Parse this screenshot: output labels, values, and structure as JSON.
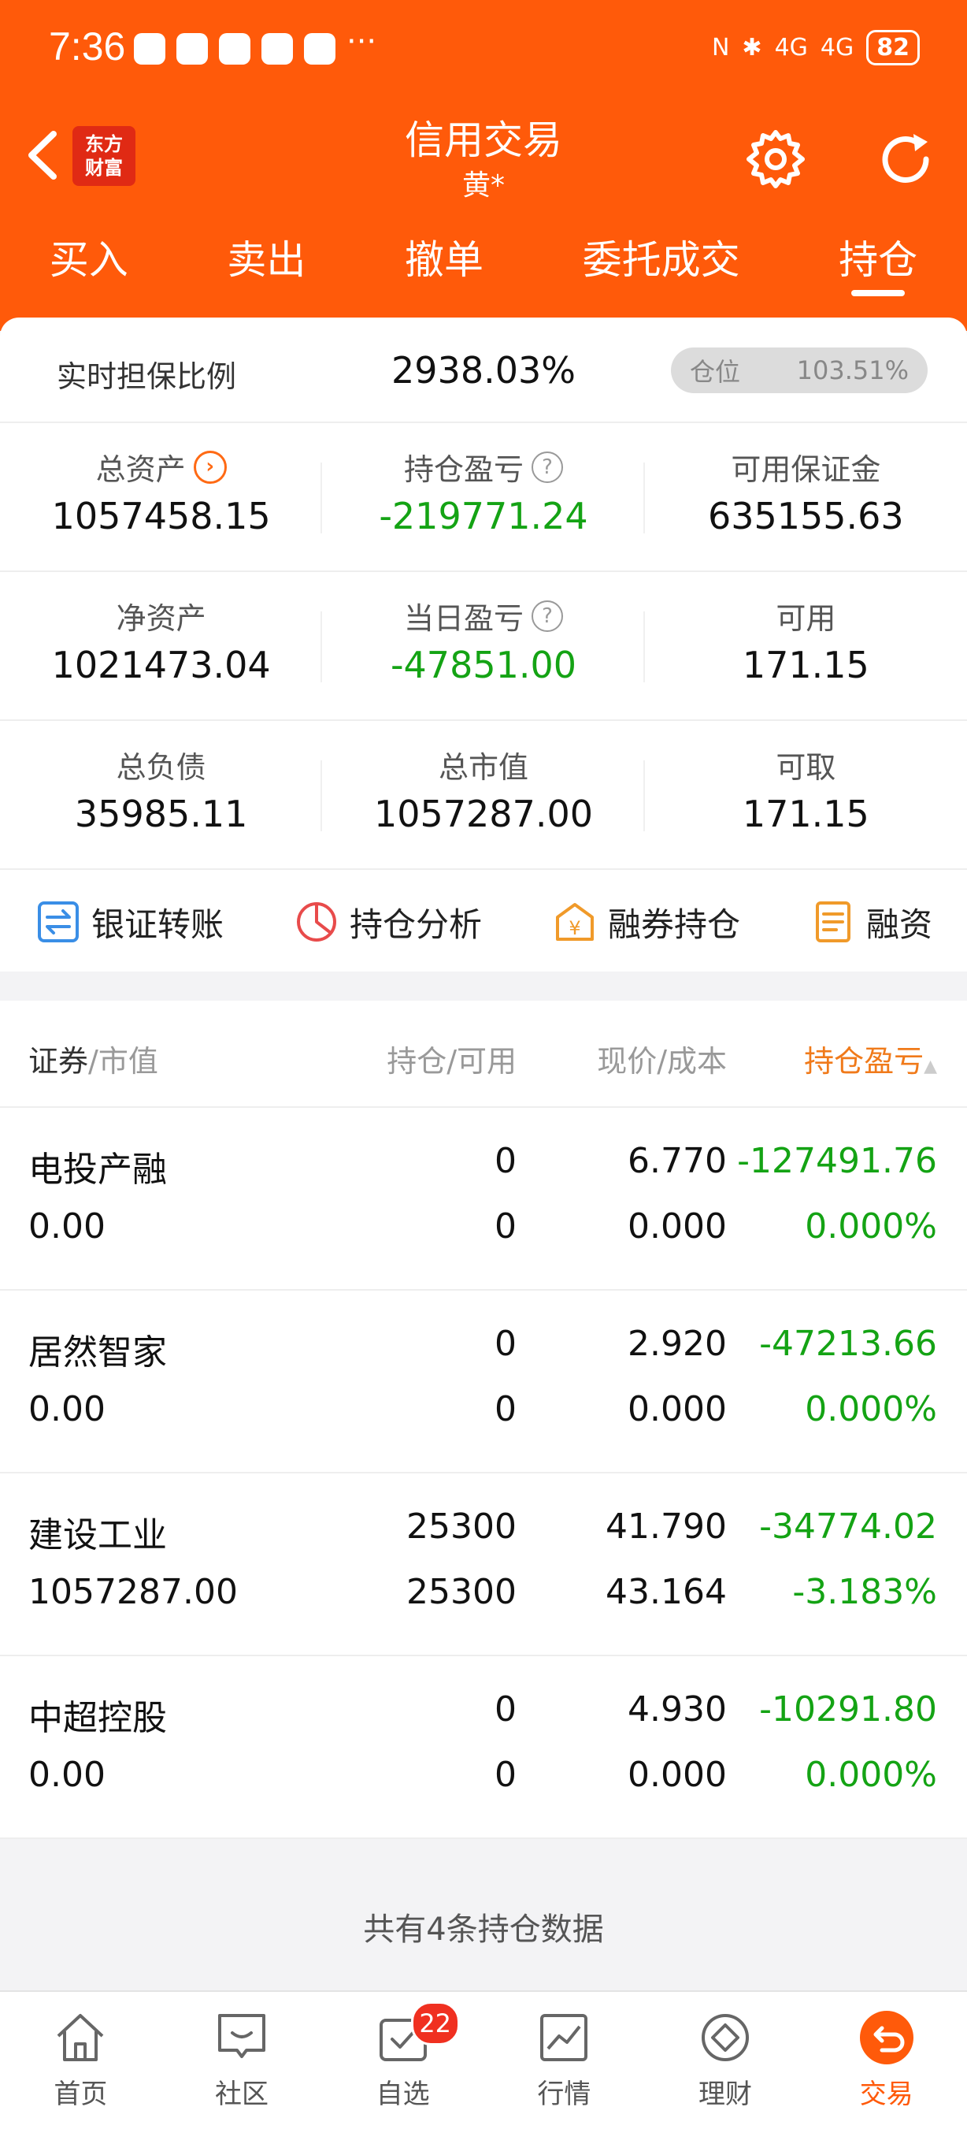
{
  "status_bar": {
    "time": "7:36",
    "more": "···",
    "network1": "4G",
    "network2": "4G",
    "battery": "82"
  },
  "nav": {
    "title": "信用交易",
    "subtitle": "黄*",
    "logo_line1": "东方",
    "logo_line2": "财富"
  },
  "tabs": [
    {
      "label": "买入",
      "active": false
    },
    {
      "label": "卖出",
      "active": false
    },
    {
      "label": "撤单",
      "active": false
    },
    {
      "label": "委托成交",
      "active": false
    },
    {
      "label": "持仓",
      "active": true
    }
  ],
  "summary": {
    "ratio_label": "实时担保比例",
    "ratio_value": "2938.03%",
    "position_label": "仓位",
    "position_value": "103.51%"
  },
  "metrics": [
    [
      {
        "label": "总资产",
        "value": "1057458.15",
        "icon": "arrow",
        "green": false
      },
      {
        "label": "持仓盈亏",
        "value": "-219771.24",
        "icon": "info",
        "green": true
      },
      {
        "label": "可用保证金",
        "value": "635155.63",
        "icon": "",
        "green": false
      }
    ],
    [
      {
        "label": "净资产",
        "value": "1021473.04",
        "icon": "",
        "green": false
      },
      {
        "label": "当日盈亏",
        "value": "-47851.00",
        "icon": "info",
        "green": true
      },
      {
        "label": "可用",
        "value": "171.15",
        "icon": "",
        "green": false
      }
    ],
    [
      {
        "label": "总负债",
        "value": "35985.11",
        "icon": "",
        "green": false
      },
      {
        "label": "总市值",
        "value": "1057287.00",
        "icon": "",
        "green": false
      },
      {
        "label": "可取",
        "value": "171.15",
        "icon": "",
        "green": false
      }
    ]
  ],
  "actions": [
    {
      "label": "银证转账",
      "icon": "transfer-icon"
    },
    {
      "label": "持仓分析",
      "icon": "pie-chart-icon"
    },
    {
      "label": "融券持仓",
      "icon": "yuan-house-icon"
    },
    {
      "label": "融资",
      "icon": "document-icon"
    }
  ],
  "table": {
    "headers": {
      "col1_primary": "证券",
      "col1_secondary": "/市值",
      "col2": "持仓/可用",
      "col3": "现价/成本",
      "col4": "持仓盈亏"
    },
    "rows": [
      {
        "name": "电投产融",
        "market_value": "0.00",
        "holding": "0",
        "available": "0",
        "price": "6.770",
        "cost": "0.000",
        "pnl": "-127491.76",
        "pnl_pct": "0.000%"
      },
      {
        "name": "居然智家",
        "market_value": "0.00",
        "holding": "0",
        "available": "0",
        "price": "2.920",
        "cost": "0.000",
        "pnl": "-47213.66",
        "pnl_pct": "0.000%"
      },
      {
        "name": "建设工业",
        "market_value": "1057287.00",
        "holding": "25300",
        "available": "25300",
        "price": "41.790",
        "cost": "43.164",
        "pnl": "-34774.02",
        "pnl_pct": "-3.183%"
      },
      {
        "name": "中超控股",
        "market_value": "0.00",
        "holding": "0",
        "available": "0",
        "price": "4.930",
        "cost": "0.000",
        "pnl": "-10291.80",
        "pnl_pct": "0.000%"
      }
    ]
  },
  "footer_note": "共有4条持仓数据",
  "bottom_nav": [
    {
      "label": "首页",
      "icon": "home-icon",
      "active": false,
      "badge": ""
    },
    {
      "label": "社区",
      "icon": "chat-icon",
      "active": false,
      "badge": ""
    },
    {
      "label": "自选",
      "icon": "watchlist-icon",
      "active": false,
      "badge": "22"
    },
    {
      "label": "行情",
      "icon": "market-chart-icon",
      "active": false,
      "badge": ""
    },
    {
      "label": "理财",
      "icon": "wealth-icon",
      "active": false,
      "badge": ""
    },
    {
      "label": "交易",
      "icon": "trade-icon",
      "active": true,
      "badge": ""
    }
  ],
  "colors": {
    "brand": "#ff5a0a",
    "loss_green": "#14a314",
    "header_accent": "#f07a1a"
  }
}
